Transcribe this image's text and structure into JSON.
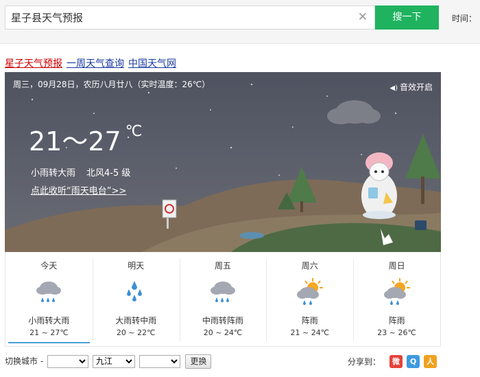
{
  "search": {
    "value": "星子县天气预报",
    "button": "搜一下",
    "time_label": "时间："
  },
  "links": [
    "星子天气预报",
    "一周天气查询",
    "中国天气网"
  ],
  "current": {
    "date_line": "周三，09月28日，农历八月廿八（实时温度：26℃）",
    "sound": "音效开启",
    "temp_range": "21～27",
    "temp_unit": "℃",
    "condition": "小雨转大雨",
    "wind": "北风4-5 级",
    "radio_link": "点此收听“雨天电台”>>"
  },
  "forecast": [
    {
      "day": "今天",
      "icon": "rain-cloud-icon",
      "condition": "小雨转大雨",
      "temp": "21 ~ 27℃"
    },
    {
      "day": "明天",
      "icon": "heavy-rain-drops-icon",
      "condition": "大雨转中雨",
      "temp": "20 ~ 22℃"
    },
    {
      "day": "周五",
      "icon": "rain-cloud-icon",
      "condition": "中雨转阵雨",
      "temp": "20 ~ 24℃"
    },
    {
      "day": "周六",
      "icon": "sun-rain-icon",
      "condition": "阵雨",
      "temp": "21 ~ 24℃"
    },
    {
      "day": "周日",
      "icon": "sun-rain-icon",
      "condition": "阵雨",
      "temp": "23 ~ 26℃"
    }
  ],
  "bottom": {
    "switch_label": "切换城市 -",
    "select1": "",
    "select2": "九江",
    "select3": "",
    "change_button": "更换",
    "share_label": "分享到："
  },
  "colors": {
    "accent_green": "#1fb35f",
    "link_red": "#cc0000",
    "link_blue": "#1a3aa0",
    "active_underline": "#4a9fd5"
  }
}
